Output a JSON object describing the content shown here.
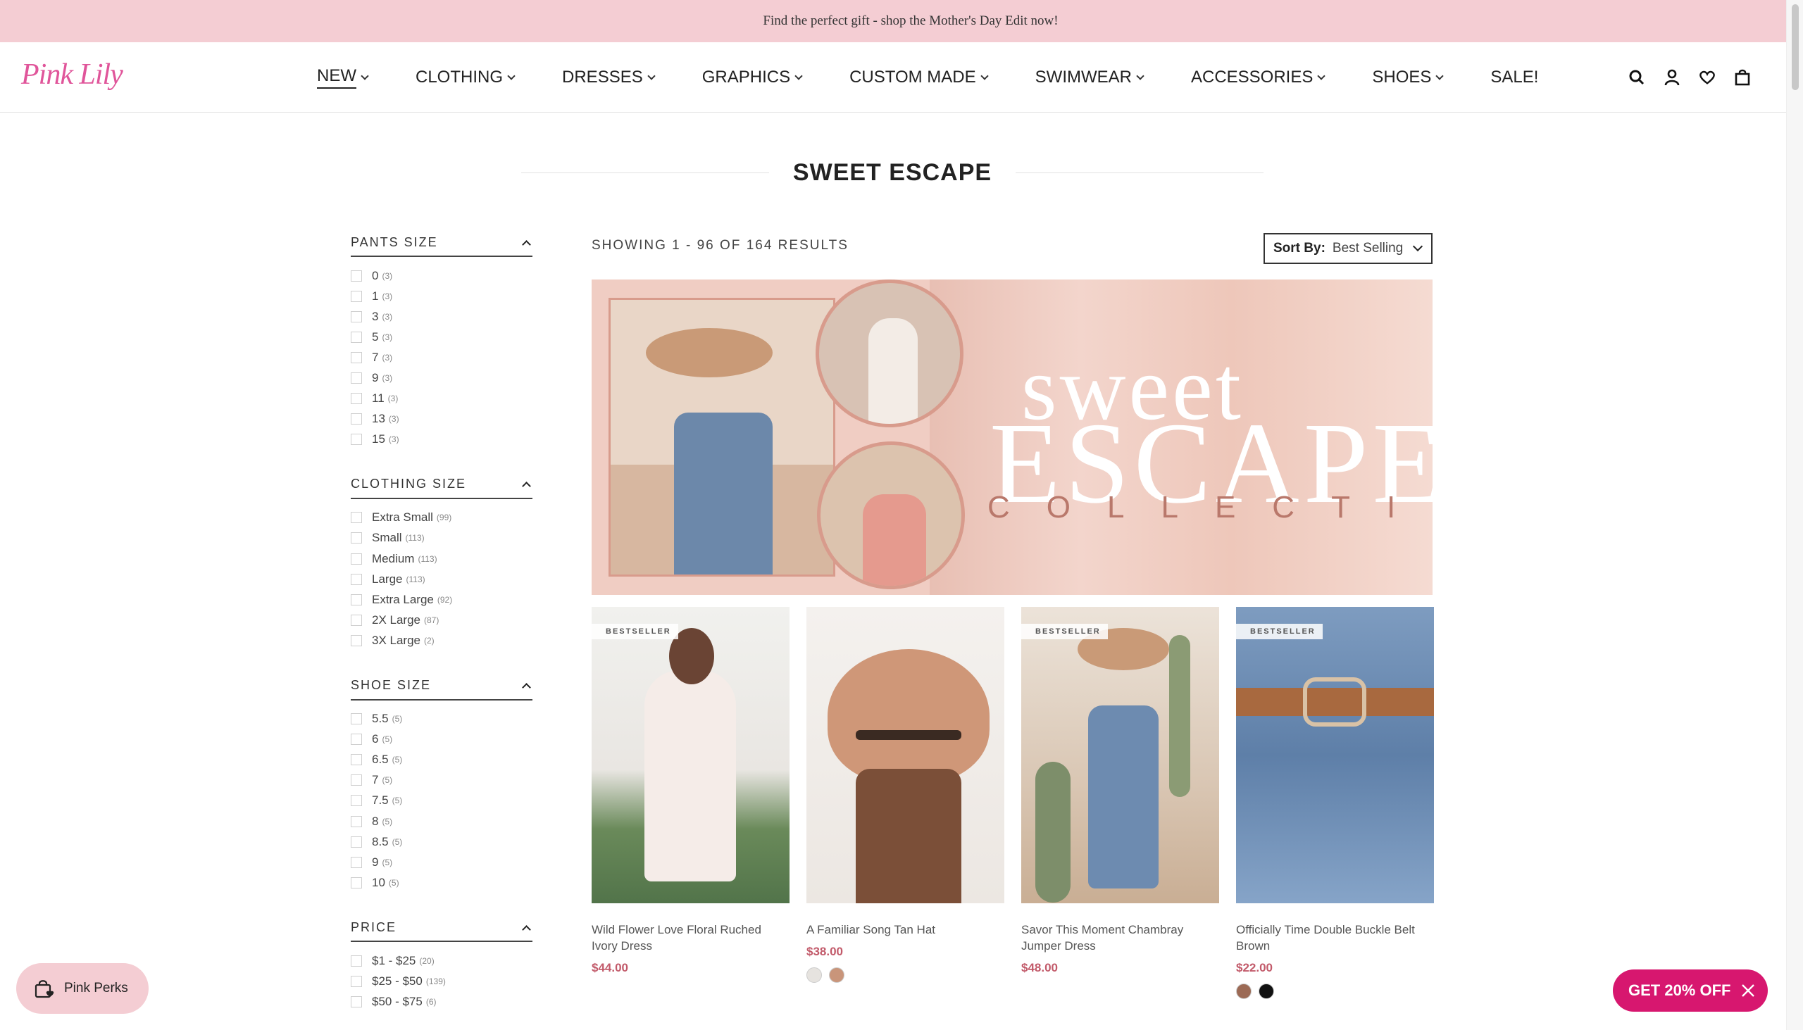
{
  "announcement": "Find the perfect gift - shop the Mother's Day Edit now!",
  "brand": "Pink Lily",
  "nav": [
    {
      "label": "NEW",
      "dropdown": true,
      "active": true
    },
    {
      "label": "CLOTHING",
      "dropdown": true
    },
    {
      "label": "DRESSES",
      "dropdown": true
    },
    {
      "label": "GRAPHICS",
      "dropdown": true
    },
    {
      "label": "CUSTOM MADE",
      "dropdown": true
    },
    {
      "label": "SWIMWEAR",
      "dropdown": true
    },
    {
      "label": "ACCESSORIES",
      "dropdown": true
    },
    {
      "label": "SHOES",
      "dropdown": true
    },
    {
      "label": "SALE!",
      "dropdown": false
    }
  ],
  "header_icons": [
    "search-icon",
    "account-icon",
    "wishlist-heart-icon",
    "cart-bag-icon"
  ],
  "page_title": "SWEET ESCAPE",
  "results": {
    "showing": "SHOWING 1 - 96 OF 164 RESULTS",
    "sort_label": "Sort By:",
    "sort_value": "Best Selling"
  },
  "filters": [
    {
      "title": "PANTS SIZE",
      "options": [
        {
          "label": "0",
          "count": "(3)"
        },
        {
          "label": "1",
          "count": "(3)"
        },
        {
          "label": "3",
          "count": "(3)"
        },
        {
          "label": "5",
          "count": "(3)"
        },
        {
          "label": "7",
          "count": "(3)"
        },
        {
          "label": "9",
          "count": "(3)"
        },
        {
          "label": "11",
          "count": "(3)"
        },
        {
          "label": "13",
          "count": "(3)"
        },
        {
          "label": "15",
          "count": "(3)"
        }
      ]
    },
    {
      "title": "CLOTHING SIZE",
      "options": [
        {
          "label": "Extra Small",
          "count": "(99)"
        },
        {
          "label": "Small",
          "count": "(113)"
        },
        {
          "label": "Medium",
          "count": "(113)"
        },
        {
          "label": "Large",
          "count": "(113)"
        },
        {
          "label": "Extra Large",
          "count": "(92)"
        },
        {
          "label": "2X Large",
          "count": "(87)"
        },
        {
          "label": "3X Large",
          "count": "(2)"
        }
      ]
    },
    {
      "title": "SHOE SIZE",
      "options": [
        {
          "label": "5.5",
          "count": "(5)"
        },
        {
          "label": "6",
          "count": "(5)"
        },
        {
          "label": "6.5",
          "count": "(5)"
        },
        {
          "label": "7",
          "count": "(5)"
        },
        {
          "label": "7.5",
          "count": "(5)"
        },
        {
          "label": "8",
          "count": "(5)"
        },
        {
          "label": "8.5",
          "count": "(5)"
        },
        {
          "label": "9",
          "count": "(5)"
        },
        {
          "label": "10",
          "count": "(5)"
        }
      ]
    },
    {
      "title": "PRICE",
      "options": [
        {
          "label": "$1 - $25",
          "count": "(20)"
        },
        {
          "label": "$25 - $50",
          "count": "(139)"
        },
        {
          "label": "$50 - $75",
          "count": "(6)"
        }
      ]
    }
  ],
  "banner": {
    "line1": "sweet",
    "line2": "ESCAPE",
    "line3": "COLLECTION"
  },
  "products": [
    {
      "badge": "BESTSELLER",
      "name": "Wild Flower Love Floral Ruched Ivory Dress",
      "price": "$44.00",
      "swatches": []
    },
    {
      "badge": "",
      "name": "A Familiar Song Tan Hat",
      "price": "$38.00",
      "swatches": [
        "#e6e3df",
        "#c9957a"
      ]
    },
    {
      "badge": "BESTSELLER",
      "name": "Savor This Moment Chambray Jumper Dress",
      "price": "$48.00",
      "swatches": []
    },
    {
      "badge": "BESTSELLER",
      "name": "Officially Time Double Buckle Belt Brown",
      "price": "$22.00",
      "swatches": [
        "#9c6a55",
        "#111111"
      ]
    }
  ],
  "perks_label": "Pink Perks",
  "promo_label": "GET 20% OFF",
  "colors": {
    "announce_bg": "#f4cdd3",
    "price": "#c25a6a",
    "promo": "#d7176f",
    "logo": "#e0559a"
  }
}
